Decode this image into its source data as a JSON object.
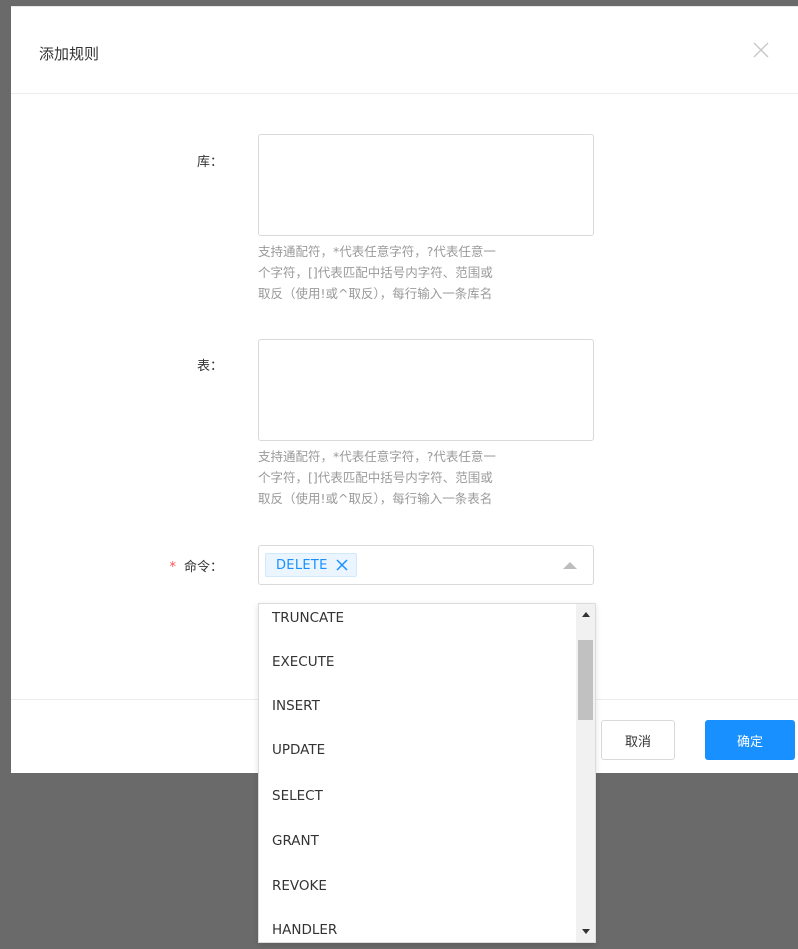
{
  "dialog": {
    "title": "添加规则",
    "close_icon": "close-icon"
  },
  "form": {
    "db_label": "库：",
    "db_value": "",
    "db_hint_lines": [
      "支持通配符，*代表任意字符，?代表任意一",
      "个字符，[]代表匹配中括号内字符、范围或",
      "取反（使用!或^取反），每行输入一条库名"
    ],
    "table_label": "表：",
    "table_value": "",
    "table_hint_lines": [
      "支持通配符，*代表任意字符，?代表任意一",
      "个字符，[]代表匹配中括号内字符、范围或",
      "取反（使用!或^取反），每行输入一条表名"
    ],
    "command_required_mark": "*",
    "command_label": "命令：",
    "selected_tags": [
      "DELETE"
    ]
  },
  "dropdown": {
    "options": [
      "TRUNCATE",
      "EXECUTE",
      "INSERT",
      "UPDATE",
      "SELECT",
      "GRANT",
      "REVOKE",
      "HANDLER"
    ]
  },
  "footer": {
    "cancel_label": "取消",
    "ok_label": "确定"
  },
  "colors": {
    "primary": "#1890ff",
    "required": "#ff4d4f",
    "hint": "#9a9a9a",
    "overlay": "#6a6a6a"
  }
}
